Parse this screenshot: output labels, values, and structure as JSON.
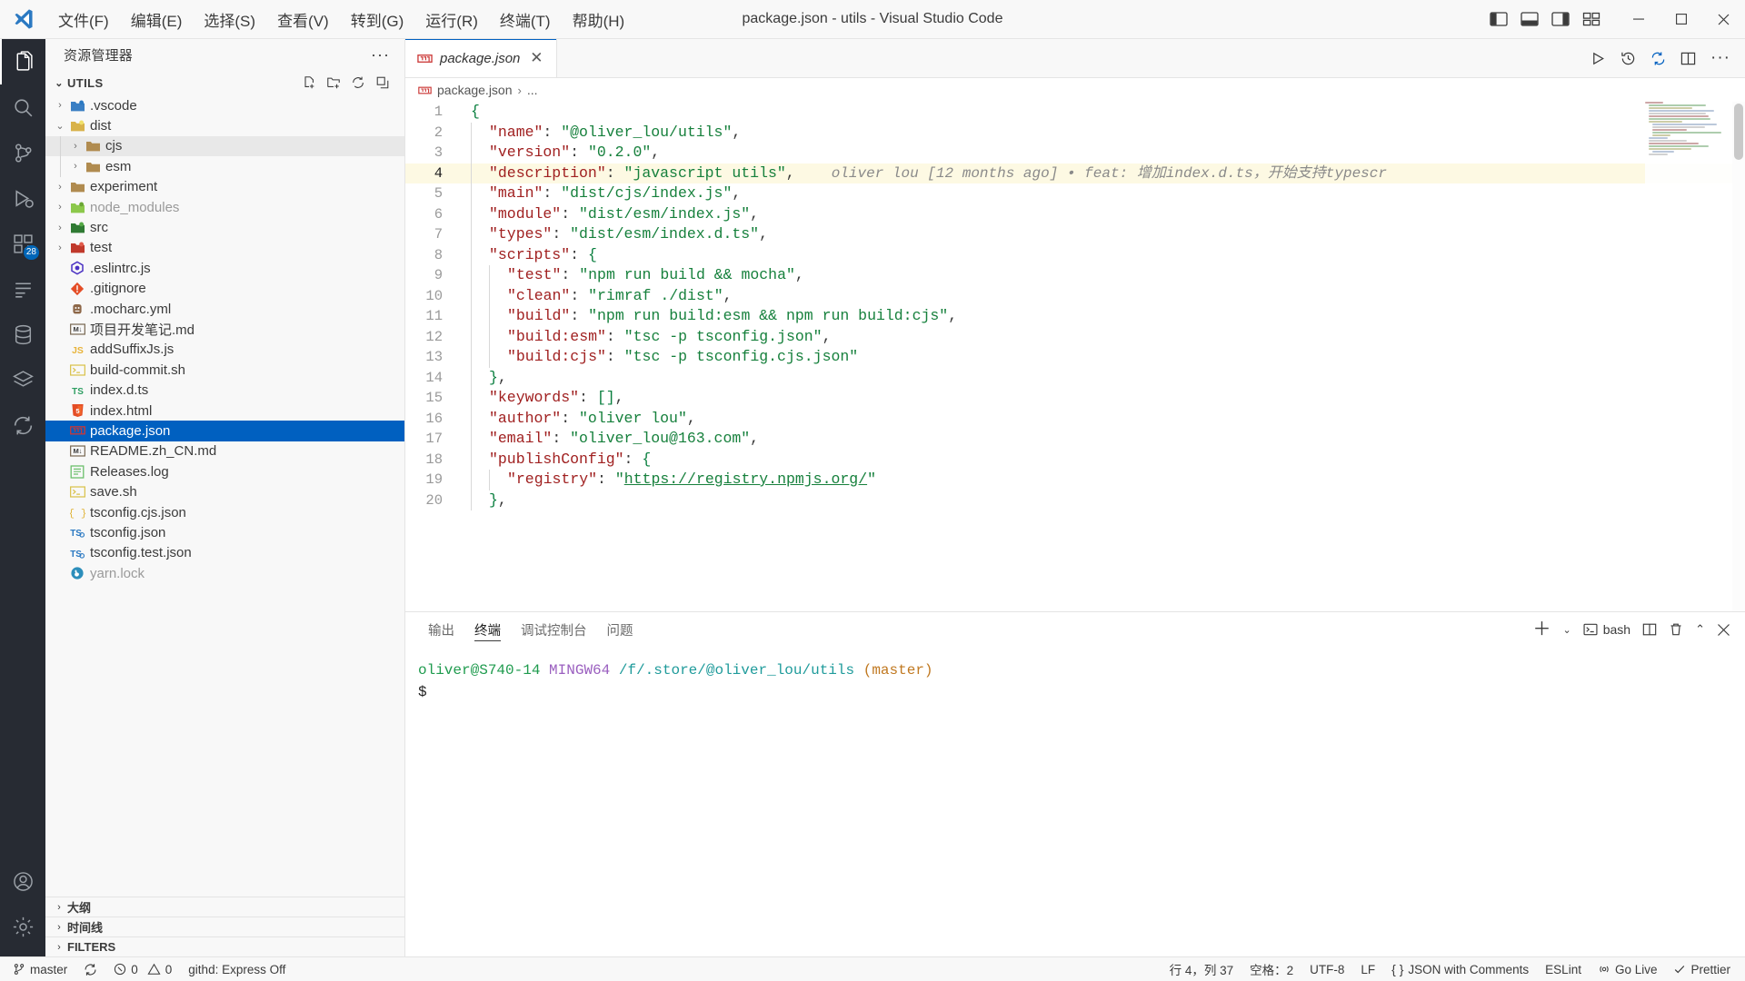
{
  "titlebar": {
    "title": "package.json - utils - Visual Studio Code",
    "menu": [
      "文件(F)",
      "编辑(E)",
      "选择(S)",
      "查看(V)",
      "转到(G)",
      "运行(R)",
      "终端(T)",
      "帮助(H)"
    ],
    "layout_icons": [
      "toggle-primary-sidebar-icon",
      "toggle-panel-icon",
      "toggle-secondary-sidebar-icon",
      "customize-layout-icon"
    ],
    "window_controls": [
      "minimize",
      "maximize",
      "close"
    ]
  },
  "activitybar": {
    "items": [
      {
        "name": "explorer",
        "icon": "files-icon",
        "active": true,
        "badge": ""
      },
      {
        "name": "search",
        "icon": "search-icon",
        "active": false,
        "badge": ""
      },
      {
        "name": "source-control",
        "icon": "source-control-icon",
        "active": false,
        "badge": ""
      },
      {
        "name": "run-and-debug",
        "icon": "debug-icon",
        "active": false,
        "badge": ""
      },
      {
        "name": "extensions",
        "icon": "extensions-icon",
        "active": false,
        "badge": "28"
      },
      {
        "name": "outline-view",
        "icon": "list-icon",
        "active": false,
        "badge": ""
      },
      {
        "name": "database",
        "icon": "database-icon",
        "active": false,
        "badge": ""
      },
      {
        "name": "layers",
        "icon": "layers-icon",
        "active": false,
        "badge": ""
      },
      {
        "name": "sync",
        "icon": "sync-icon",
        "active": false,
        "badge": ""
      }
    ],
    "bottom": [
      {
        "name": "accounts",
        "icon": "account-icon"
      },
      {
        "name": "manage",
        "icon": "gear-icon"
      }
    ]
  },
  "sidebar": {
    "title": "资源管理器",
    "more_actions": "···",
    "root": {
      "label": "UTILS",
      "actions": [
        "new-file-icon",
        "new-folder-icon",
        "refresh-icon",
        "collapse-all-icon"
      ]
    },
    "tree": [
      {
        "label": ".vscode",
        "depth": 1,
        "type": "folder",
        "expanded": false,
        "icon": "vscode-folder-icon",
        "state": "normal"
      },
      {
        "label": "dist",
        "depth": 1,
        "type": "folder",
        "expanded": true,
        "icon": "dist-folder-icon",
        "state": "normal"
      },
      {
        "label": "cjs",
        "depth": 2,
        "type": "folder",
        "expanded": false,
        "icon": "folder-icon",
        "state": "hover"
      },
      {
        "label": "esm",
        "depth": 2,
        "type": "folder",
        "expanded": false,
        "icon": "folder-icon",
        "state": "normal"
      },
      {
        "label": "experiment",
        "depth": 1,
        "type": "folder",
        "expanded": false,
        "icon": "folder-icon",
        "state": "normal"
      },
      {
        "label": "node_modules",
        "depth": 1,
        "type": "folder",
        "expanded": false,
        "icon": "node-folder-icon",
        "state": "dim"
      },
      {
        "label": "src",
        "depth": 1,
        "type": "folder",
        "expanded": false,
        "icon": "src-folder-icon",
        "state": "normal"
      },
      {
        "label": "test",
        "depth": 1,
        "type": "folder",
        "expanded": false,
        "icon": "test-folder-icon",
        "state": "normal"
      },
      {
        "label": ".eslintrc.js",
        "depth": 1,
        "type": "file",
        "icon": "eslint-icon",
        "state": "normal"
      },
      {
        "label": ".gitignore",
        "depth": 1,
        "type": "file",
        "icon": "git-icon",
        "state": "normal"
      },
      {
        "label": ".mocharc.yml",
        "depth": 1,
        "type": "file",
        "icon": "mocha-icon",
        "state": "normal"
      },
      {
        "label": "项目开发笔记.md",
        "depth": 1,
        "type": "file",
        "icon": "markdown-icon",
        "state": "normal"
      },
      {
        "label": "addSuffixJs.js",
        "depth": 1,
        "type": "file",
        "icon": "javascript-icon",
        "state": "normal"
      },
      {
        "label": "build-commit.sh",
        "depth": 1,
        "type": "file",
        "icon": "shell-icon",
        "state": "normal"
      },
      {
        "label": "index.d.ts",
        "depth": 1,
        "type": "file",
        "icon": "typescript-def-icon",
        "state": "normal"
      },
      {
        "label": "index.html",
        "depth": 1,
        "type": "file",
        "icon": "html-icon",
        "state": "normal"
      },
      {
        "label": "package.json",
        "depth": 1,
        "type": "file",
        "icon": "npm-icon",
        "state": "selected"
      },
      {
        "label": "README.zh_CN.md",
        "depth": 1,
        "type": "file",
        "icon": "markdown-icon",
        "state": "normal"
      },
      {
        "label": "Releases.log",
        "depth": 1,
        "type": "file",
        "icon": "log-icon",
        "state": "normal"
      },
      {
        "label": "save.sh",
        "depth": 1,
        "type": "file",
        "icon": "shell-icon",
        "state": "normal"
      },
      {
        "label": "tsconfig.cjs.json",
        "depth": 1,
        "type": "file",
        "icon": "json-icon",
        "state": "normal"
      },
      {
        "label": "tsconfig.json",
        "depth": 1,
        "type": "file",
        "icon": "tsconfig-icon",
        "state": "normal"
      },
      {
        "label": "tsconfig.test.json",
        "depth": 1,
        "type": "file",
        "icon": "tsconfig-icon",
        "state": "normal"
      },
      {
        "label": "yarn.lock",
        "depth": 1,
        "type": "file",
        "icon": "yarn-icon",
        "state": "dim"
      }
    ],
    "bottom_sections": [
      "大纲",
      "时间线",
      "FILTERS"
    ]
  },
  "editor": {
    "tab": {
      "name": "package.json",
      "icon": "npm-icon",
      "close": "✕"
    },
    "tab_actions": [
      "run-icon",
      "history-icon",
      "sync-changes-icon",
      "split-editor-icon",
      "more-actions-icon"
    ],
    "breadcrumb": [
      "package.json",
      "..."
    ],
    "blame": "oliver lou [12 months ago] • feat: 增加index.d.ts，开始支持typescr",
    "lines": [
      {
        "no": 1,
        "indent": 0,
        "tokens": [
          {
            "t": "{",
            "c": "br"
          }
        ]
      },
      {
        "no": 2,
        "indent": 1,
        "tokens": [
          {
            "t": "\"name\"",
            "c": "k"
          },
          {
            "t": ": ",
            "c": "p"
          },
          {
            "t": "\"@oliver_lou/utils\"",
            "c": "s"
          },
          {
            "t": ",",
            "c": "p"
          }
        ]
      },
      {
        "no": 3,
        "indent": 1,
        "tokens": [
          {
            "t": "\"version\"",
            "c": "k"
          },
          {
            "t": ": ",
            "c": "p"
          },
          {
            "t": "\"0.2.0\"",
            "c": "s"
          },
          {
            "t": ",",
            "c": "p"
          }
        ]
      },
      {
        "no": 4,
        "indent": 1,
        "current": true,
        "tokens": [
          {
            "t": "\"description\"",
            "c": "k"
          },
          {
            "t": ": ",
            "c": "p"
          },
          {
            "t": "\"javascript utils\"",
            "c": "s"
          },
          {
            "t": ",",
            "c": "p"
          }
        ]
      },
      {
        "no": 5,
        "indent": 1,
        "tokens": [
          {
            "t": "\"main\"",
            "c": "k"
          },
          {
            "t": ": ",
            "c": "p"
          },
          {
            "t": "\"dist/cjs/index.js\"",
            "c": "s"
          },
          {
            "t": ",",
            "c": "p"
          }
        ]
      },
      {
        "no": 6,
        "indent": 1,
        "tokens": [
          {
            "t": "\"module\"",
            "c": "k"
          },
          {
            "t": ": ",
            "c": "p"
          },
          {
            "t": "\"dist/esm/index.js\"",
            "c": "s"
          },
          {
            "t": ",",
            "c": "p"
          }
        ]
      },
      {
        "no": 7,
        "indent": 1,
        "tokens": [
          {
            "t": "\"types\"",
            "c": "k"
          },
          {
            "t": ": ",
            "c": "p"
          },
          {
            "t": "\"dist/esm/index.d.ts\"",
            "c": "s"
          },
          {
            "t": ",",
            "c": "p"
          }
        ]
      },
      {
        "no": 8,
        "indent": 1,
        "tokens": [
          {
            "t": "\"scripts\"",
            "c": "k"
          },
          {
            "t": ": ",
            "c": "p"
          },
          {
            "t": "{",
            "c": "br"
          }
        ]
      },
      {
        "no": 9,
        "indent": 2,
        "tokens": [
          {
            "t": "\"test\"",
            "c": "k"
          },
          {
            "t": ": ",
            "c": "p"
          },
          {
            "t": "\"npm run build && mocha\"",
            "c": "s"
          },
          {
            "t": ",",
            "c": "p"
          }
        ]
      },
      {
        "no": 10,
        "indent": 2,
        "tokens": [
          {
            "t": "\"clean\"",
            "c": "k"
          },
          {
            "t": ": ",
            "c": "p"
          },
          {
            "t": "\"rimraf ./dist\"",
            "c": "s"
          },
          {
            "t": ",",
            "c": "p"
          }
        ]
      },
      {
        "no": 11,
        "indent": 2,
        "tokens": [
          {
            "t": "\"build\"",
            "c": "k"
          },
          {
            "t": ": ",
            "c": "p"
          },
          {
            "t": "\"npm run build:esm && npm run build:cjs\"",
            "c": "s"
          },
          {
            "t": ",",
            "c": "p"
          }
        ]
      },
      {
        "no": 12,
        "indent": 2,
        "tokens": [
          {
            "t": "\"build:esm\"",
            "c": "k"
          },
          {
            "t": ": ",
            "c": "p"
          },
          {
            "t": "\"tsc -p tsconfig.json\"",
            "c": "s"
          },
          {
            "t": ",",
            "c": "p"
          }
        ]
      },
      {
        "no": 13,
        "indent": 2,
        "tokens": [
          {
            "t": "\"build:cjs\"",
            "c": "k"
          },
          {
            "t": ": ",
            "c": "p"
          },
          {
            "t": "\"tsc -p tsconfig.cjs.json\"",
            "c": "s"
          }
        ]
      },
      {
        "no": 14,
        "indent": 1,
        "tokens": [
          {
            "t": "}",
            "c": "br"
          },
          {
            "t": ",",
            "c": "p"
          }
        ]
      },
      {
        "no": 15,
        "indent": 1,
        "tokens": [
          {
            "t": "\"keywords\"",
            "c": "k"
          },
          {
            "t": ": ",
            "c": "p"
          },
          {
            "t": "[]",
            "c": "br"
          },
          {
            "t": ",",
            "c": "p"
          }
        ]
      },
      {
        "no": 16,
        "indent": 1,
        "tokens": [
          {
            "t": "\"author\"",
            "c": "k"
          },
          {
            "t": ": ",
            "c": "p"
          },
          {
            "t": "\"oliver lou\"",
            "c": "s"
          },
          {
            "t": ",",
            "c": "p"
          }
        ]
      },
      {
        "no": 17,
        "indent": 1,
        "tokens": [
          {
            "t": "\"email\"",
            "c": "k"
          },
          {
            "t": ": ",
            "c": "p"
          },
          {
            "t": "\"oliver_lou@163.com\"",
            "c": "s"
          },
          {
            "t": ",",
            "c": "p"
          }
        ]
      },
      {
        "no": 18,
        "indent": 1,
        "tokens": [
          {
            "t": "\"publishConfig\"",
            "c": "k"
          },
          {
            "t": ": ",
            "c": "p"
          },
          {
            "t": "{",
            "c": "br"
          }
        ]
      },
      {
        "no": 19,
        "indent": 2,
        "tokens": [
          {
            "t": "\"registry\"",
            "c": "k"
          },
          {
            "t": ": ",
            "c": "p"
          },
          {
            "t": "\"",
            "c": "s"
          },
          {
            "t": "https://registry.npmjs.org/",
            "c": "lnk"
          },
          {
            "t": "\"",
            "c": "s"
          }
        ]
      },
      {
        "no": 20,
        "indent": 1,
        "tokens": [
          {
            "t": "}",
            "c": "br"
          },
          {
            "t": ",",
            "c": "p"
          }
        ]
      }
    ]
  },
  "panel": {
    "tabs": [
      {
        "label": "输出",
        "active": false
      },
      {
        "label": "终端",
        "active": true
      },
      {
        "label": "调试控制台",
        "active": false
      },
      {
        "label": "问题",
        "active": false
      }
    ],
    "actions": [
      "new-terminal-icon",
      "chevron-down-icon",
      "split-terminal-icon",
      "trash-icon",
      "maximize-panel-icon",
      "close-panel-icon"
    ],
    "shell_label": "bash",
    "terminal": {
      "user": "oliver@S740-14",
      "host": "MINGW64",
      "path": "/f/.store/@oliver_lou/utils",
      "branch": "(master)",
      "prompt": "$"
    }
  },
  "statusbar": {
    "left": [
      {
        "name": "branch",
        "icon": "source-control-icon",
        "label": "master"
      },
      {
        "name": "sync",
        "icon": "sync-icon",
        "label": ""
      },
      {
        "name": "problems",
        "icon": "error-warning-icon",
        "label": "0  0",
        "errors": "0",
        "warnings": "0"
      },
      {
        "name": "githd",
        "icon": "",
        "label": "githd: Express Off"
      }
    ],
    "right": [
      {
        "name": "cursor-position",
        "label": "行 4，列 37"
      },
      {
        "name": "indentation",
        "label": "空格：2"
      },
      {
        "name": "encoding",
        "label": "UTF-8"
      },
      {
        "name": "eol",
        "label": "LF"
      },
      {
        "name": "language-mode",
        "label": "JSON with Comments",
        "icon": "braces-icon"
      },
      {
        "name": "eslint",
        "label": "ESLint"
      },
      {
        "name": "go-live",
        "label": "Go Live",
        "icon": "broadcast-icon"
      },
      {
        "name": "prettier",
        "label": "Prettier",
        "icon": "check-icon"
      }
    ]
  },
  "colors": {
    "accent": "#0060c0",
    "activitybar_bg": "#272b33",
    "selection": "#0060c0",
    "current_line": "#fdf9e3",
    "string": "#16803c",
    "key": "#a02020"
  }
}
